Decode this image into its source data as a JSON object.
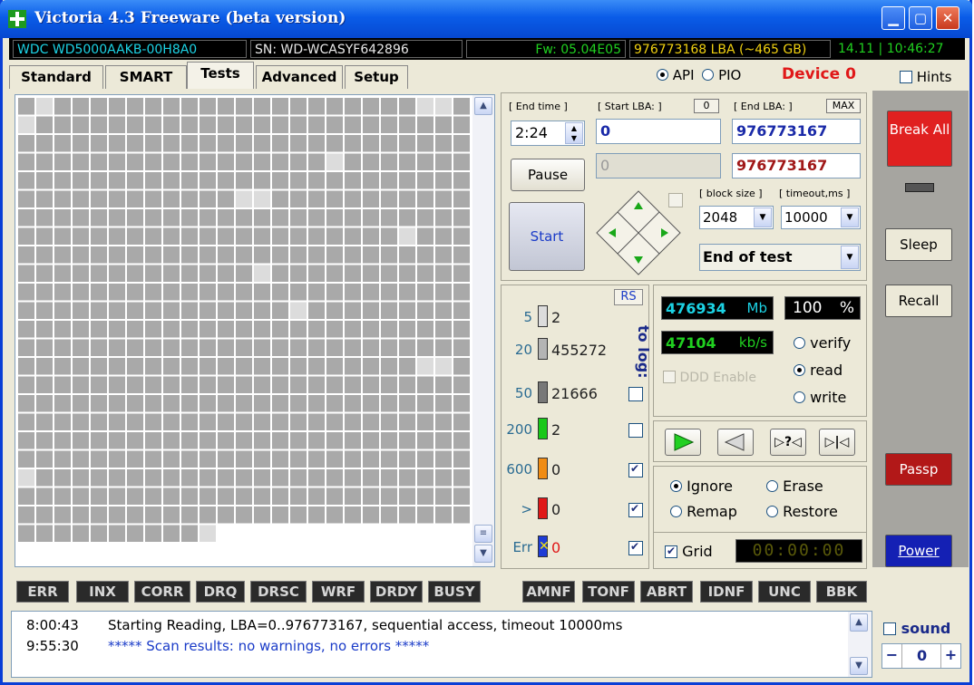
{
  "window": {
    "title": "Victoria 4.3 Freeware (beta version)"
  },
  "infobar": {
    "model": "WDC WD5000AAKB-00H8A0",
    "serial": "SN: WD-WCASYF642896",
    "firmware": "Fw: 05.04E05",
    "capacity": "976773168 LBA (~465 GB)",
    "clock": "14.11 | 10:46:27"
  },
  "tabs": [
    "Standard",
    "SMART",
    "Tests",
    "Advanced",
    "Setup"
  ],
  "mode": {
    "api": "API",
    "pio": "PIO",
    "device": "Device 0",
    "hints": "Hints"
  },
  "scan_grid": {
    "cols": 25,
    "rows": 24,
    "filled_fraction": 1.0
  },
  "params": {
    "end_time_label": "[ End time ]",
    "end_time": "2:24",
    "start_lba_label": "[ Start LBA: ]",
    "start_lba_reset": "0",
    "start_lba": "0",
    "end_lba_label": "[ End LBA: ]",
    "end_lba_max": "MAX",
    "end_lba": "976773167",
    "current_lba": "0",
    "end_lba_current": "976773167",
    "pause": "Pause",
    "start": "Start",
    "block_size_label": "[ block size ]",
    "timeout_label": "[ timeout,ms ]",
    "block_size": "2048",
    "timeout": "10000",
    "end_action": "End of test"
  },
  "legend": {
    "rs": "RS",
    "to_log": "to log:",
    "rows": [
      {
        "threshold": "5",
        "count": "2",
        "color": "#dcdcdc"
      },
      {
        "threshold": "20",
        "count": "455272",
        "color": "#b4b4b4"
      },
      {
        "threshold": "50",
        "count": "21666",
        "color": "#787878"
      },
      {
        "threshold": "200",
        "count": "2",
        "color": "#19c819"
      },
      {
        "threshold": "600",
        "count": "0",
        "color": "#f08c14"
      },
      {
        "threshold": ">",
        "count": "0",
        "color": "#e01818"
      },
      {
        "threshold": "Err",
        "count": "0",
        "color": "#1e3cd6"
      }
    ]
  },
  "stats": {
    "mb": "476934",
    "mb_unit": "Mb",
    "percent": "100",
    "percent_unit": "%",
    "speed": "47104",
    "speed_unit": "kb/s",
    "ddd": "DDD Enable",
    "verify": "verify",
    "read": "read",
    "write": "write"
  },
  "actions": {
    "ignore": "Ignore",
    "erase": "Erase",
    "remap": "Remap",
    "restore": "Restore",
    "grid": "Grid",
    "timer": "00:00:00"
  },
  "sidebar": {
    "break": "Break All",
    "sleep": "Sleep",
    "recall": "Recall",
    "passp": "Passp",
    "power": "Power"
  },
  "indicators": [
    "ERR",
    "INX",
    "CORR",
    "DRQ",
    "DRSC",
    "WRF",
    "DRDY",
    "BUSY",
    "AMNF",
    "TONF",
    "ABRT",
    "IDNF",
    "UNC",
    "BBK"
  ],
  "log": [
    {
      "time": "8:00:43",
      "msg": "Starting Reading, LBA=0..976773167, sequential access, timeout 10000ms"
    },
    {
      "time": "9:55:30",
      "msg": "***** Scan results: no warnings, no errors *****"
    }
  ],
  "sound": {
    "label": "sound",
    "value": "0",
    "minus": "−",
    "plus": "+"
  },
  "colors": {
    "title_blue": "#0a5ce8",
    "break_red": "#e02020",
    "passp_red": "#b21818",
    "power_blue": "#1420b4"
  }
}
